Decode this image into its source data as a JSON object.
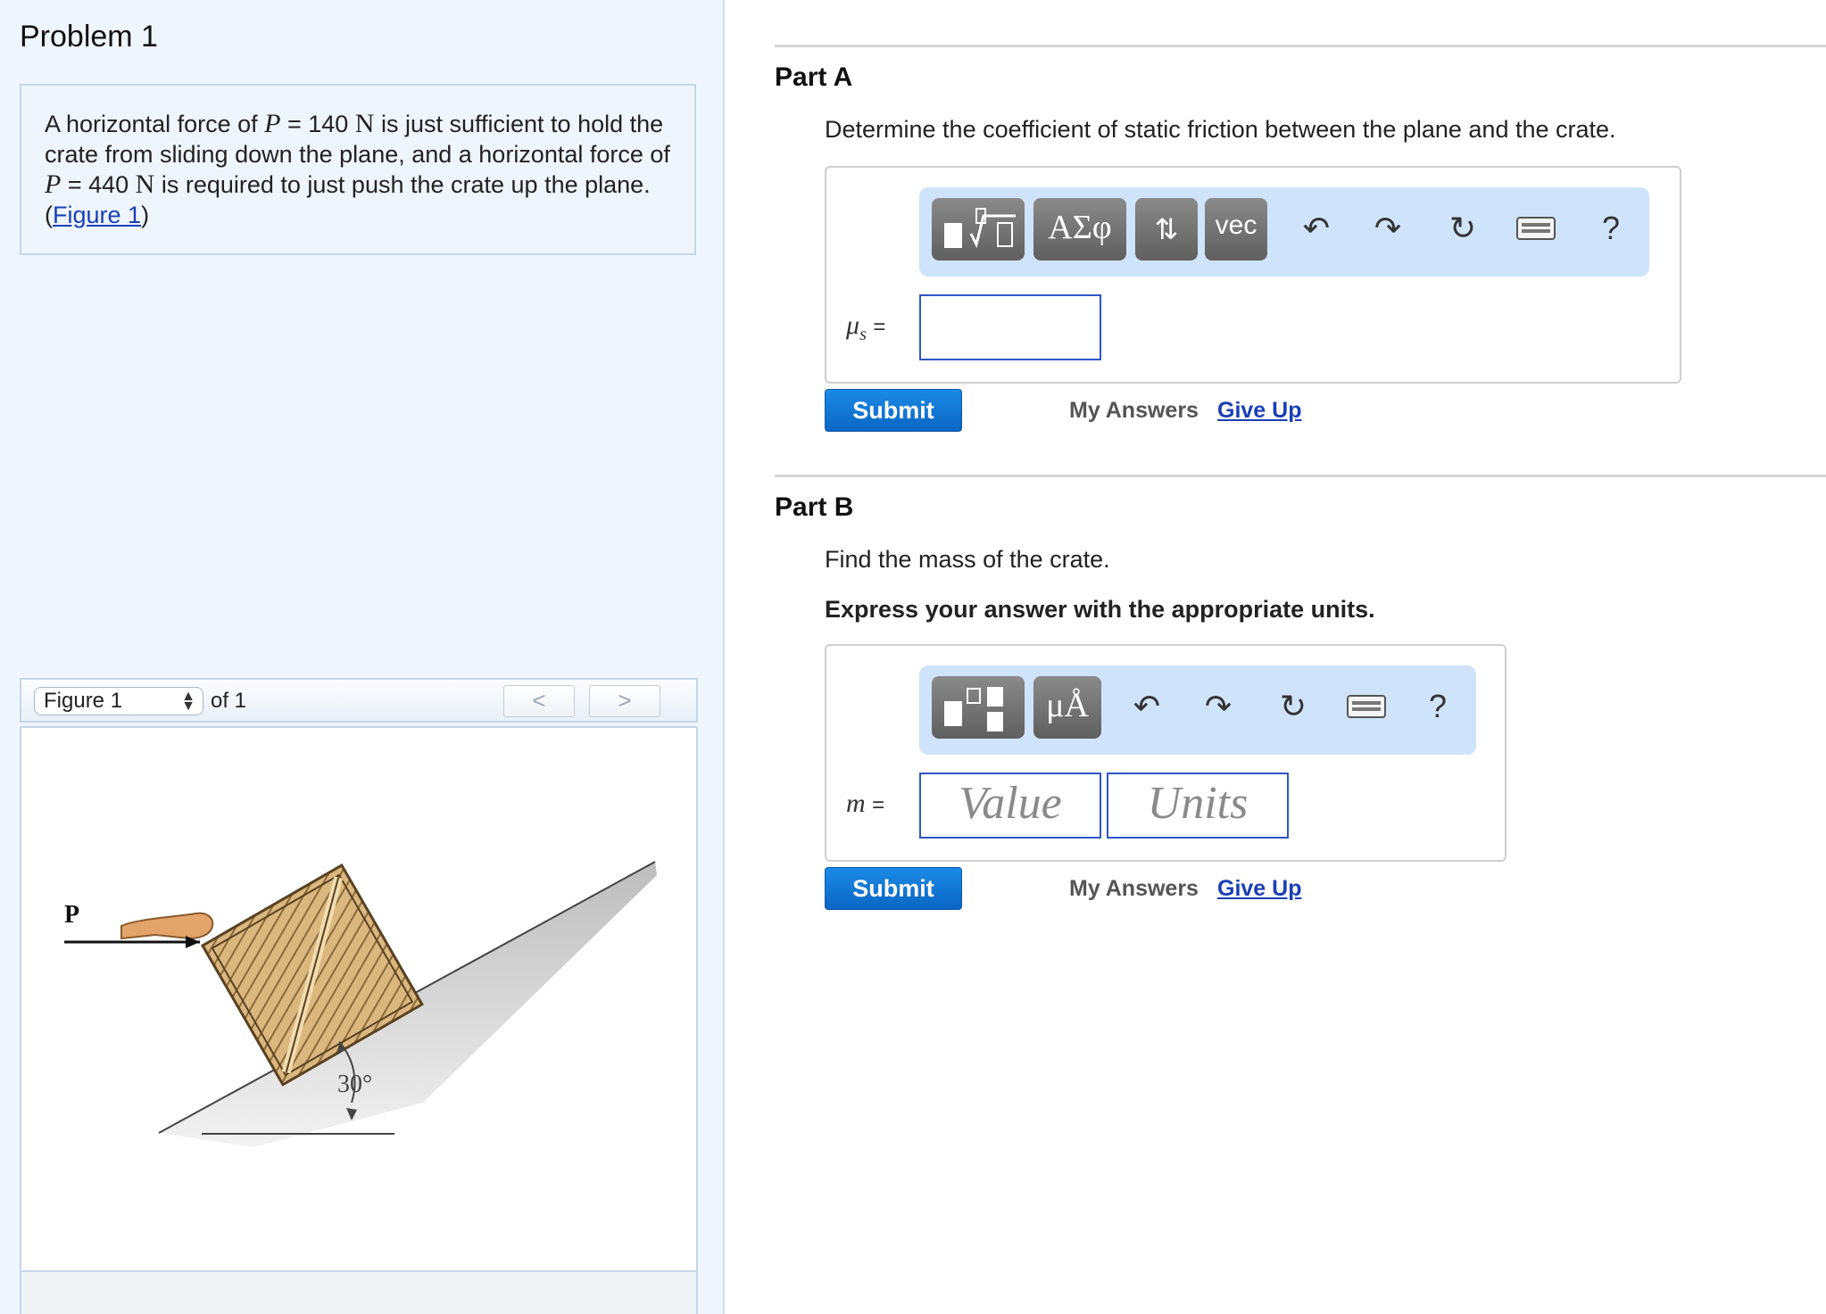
{
  "problem": {
    "title": "Problem 1",
    "statement": {
      "t1": "A horizontal force of ",
      "var": "P",
      "eq": " = 140 ",
      "unit": "N",
      "t2": " is just sufficient to hold the crate from sliding down the plane, and a horizontal force of ",
      "var2": "P",
      "eq2": " = 440 ",
      "unit2": "N",
      "t3": " is required to just push the crate up the plane.(",
      "link": "Figure 1",
      "t4": ")"
    }
  },
  "figure": {
    "select_value": "Figure 1",
    "of_text": "of 1",
    "prev_label": "<",
    "next_label": ">",
    "force_label": "P",
    "angle_label": "30°"
  },
  "partA": {
    "title": "Part A",
    "question": "Determine the coefficient of static friction between the plane and the crate.",
    "toolbar": {
      "templates_icon": "templates-icon",
      "greek_label": "ΑΣφ",
      "updown_label": "⇅",
      "vec_label": "vec",
      "icons": [
        "undo-icon",
        "redo-icon",
        "reset-icon",
        "keyboard-icon",
        "help-icon"
      ],
      "help_label": "?"
    },
    "var_label": "μ",
    "var_sub": "s",
    "eq_sign": "=",
    "input_value": ""
  },
  "partB": {
    "title": "Part B",
    "question": "Find the mass of the crate.",
    "instruction": "Express your answer with the appropriate units.",
    "toolbar": {
      "units_label": "μÅ",
      "help_label": "?"
    },
    "var_label": "m",
    "eq_sign": "=",
    "value_placeholder": "Value",
    "units_placeholder": "Units"
  },
  "actions": {
    "submit_label": "Submit",
    "my_answers_label": "My Answers",
    "give_up_label": "Give Up"
  },
  "colors": {
    "accent": "#0b66c4",
    "link": "#1a3fb5",
    "left_bg": "#eef5fd",
    "toolbar_bg": "#cfe3fb"
  }
}
